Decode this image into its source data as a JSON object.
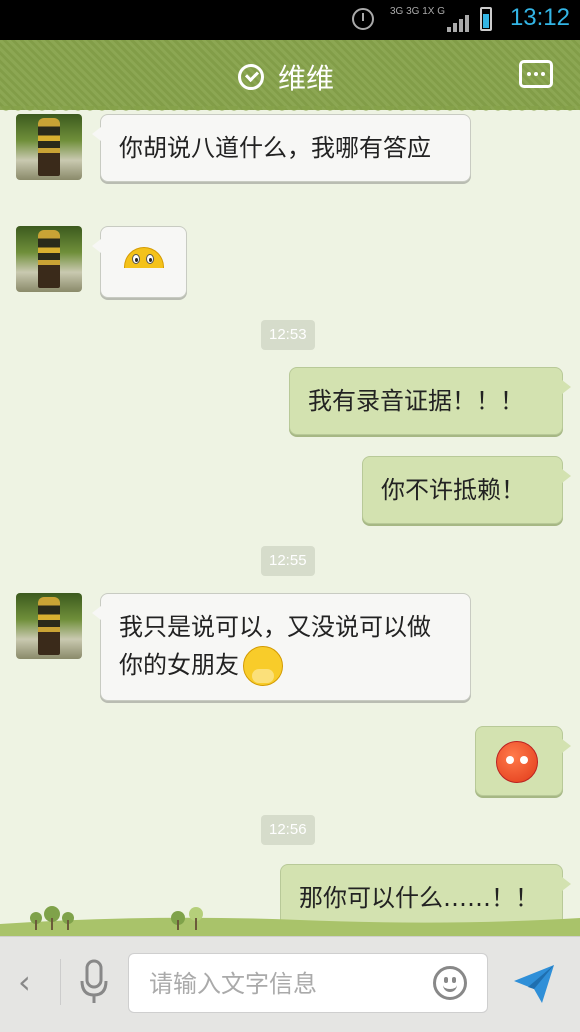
{
  "status_bar": {
    "time": "13:12",
    "network_text": "3G 3G 1X G",
    "icons": [
      "alarm-icon",
      "signal-icon",
      "battery-icon"
    ]
  },
  "header": {
    "title": "维维",
    "verified_icon": "check-circle-icon",
    "menu_icon": "more-icon"
  },
  "messages": [
    {
      "side": "in",
      "text": "你胡说八道什么，我哪有答应"
    },
    {
      "side": "in",
      "emoji": "peek-emoji"
    },
    {
      "timestamp": "12:53"
    },
    {
      "side": "out",
      "text": "我有录音证据！！！"
    },
    {
      "side": "out",
      "text": "你不许抵赖！"
    },
    {
      "timestamp": "12:55"
    },
    {
      "side": "in",
      "text": "我只是说可以，又没说可以做你的女朋友",
      "emoji": "shy-emoji"
    },
    {
      "side": "out",
      "emoji": "angry-emoji"
    },
    {
      "timestamp": "12:56"
    },
    {
      "side": "out",
      "text": "那你可以什么……！！"
    }
  ],
  "input_bar": {
    "placeholder": "请输入文字信息",
    "icons": [
      "back-icon",
      "mic-icon",
      "smiley-icon",
      "send-icon"
    ]
  },
  "colors": {
    "header": "#86a24a",
    "chat_background": "#eef3e3",
    "outgoing_bubble": "#d3e2b0",
    "incoming_bubble": "#f7f7f5",
    "time_accent": "#33b5e5"
  }
}
